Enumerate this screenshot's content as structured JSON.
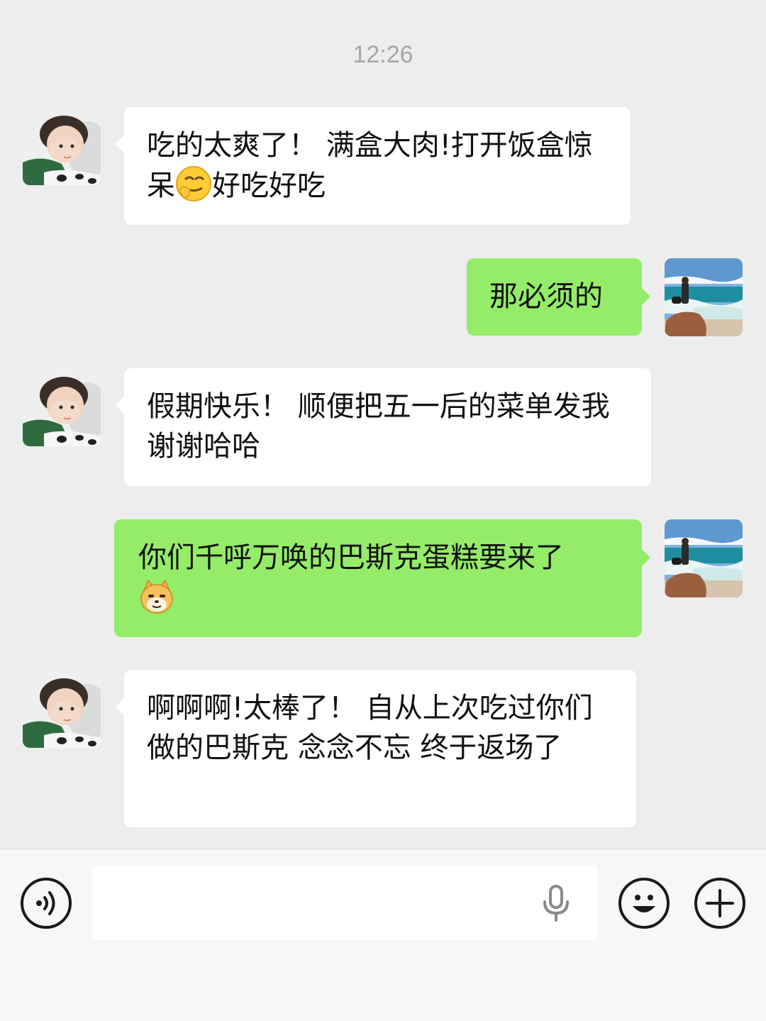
{
  "timestamp": "12:26",
  "messages": [
    {
      "direction": "in",
      "sender": "contact",
      "text_before": "吃的太爽了！ 满盒大肉!打开饭盒惊呆",
      "emoji": "smirk-face-emoji",
      "text_after": "好吃好吃"
    },
    {
      "direction": "out",
      "sender": "me",
      "text": "那必须的"
    },
    {
      "direction": "in",
      "sender": "contact",
      "text": "假期快乐！ 顺便把五一后的菜单发我谢谢哈哈"
    },
    {
      "direction": "out",
      "sender": "me",
      "text": "你们千呼万唤的巴斯克蛋糕要来了",
      "emoji": "doge-emoji"
    },
    {
      "direction": "in",
      "sender": "contact",
      "text": "啊啊啊!太棒了！ 自从上次吃过你们做的巴斯克 念念不忘 终于返场了"
    }
  ],
  "input_bar": {
    "text_value": "",
    "voice_toggle_icon": "voice-mode-icon",
    "mic_icon": "microphone-icon",
    "emoji_icon": "emoji-smile-icon",
    "plus_icon": "plus-icon"
  },
  "colors": {
    "background": "#ededed",
    "incoming_bubble": "#ffffff",
    "outgoing_bubble": "#95ec69",
    "timestamp_text": "#a6a6a6"
  }
}
